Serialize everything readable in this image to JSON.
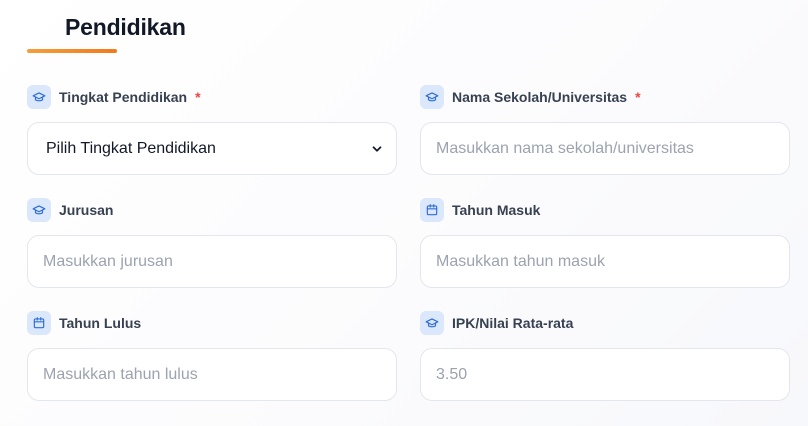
{
  "section": {
    "title": "Pendidikan",
    "accent_color": "#f17a1c"
  },
  "fields": {
    "tingkat": {
      "label": "Tingkat Pendidikan",
      "required_mark": "*",
      "selected": "Pilih Tingkat Pendidikan",
      "icon": "graduation-cap-icon"
    },
    "sekolah": {
      "label": "Nama Sekolah/Universitas",
      "required_mark": "*",
      "placeholder": "Masukkan nama sekolah/universitas",
      "icon": "graduation-cap-icon"
    },
    "jurusan": {
      "label": "Jurusan",
      "placeholder": "Masukkan jurusan",
      "icon": "graduation-cap-icon"
    },
    "tahun_masuk": {
      "label": "Tahun Masuk",
      "placeholder": "Masukkan tahun masuk",
      "icon": "calendar-icon"
    },
    "tahun_lulus": {
      "label": "Tahun Lulus",
      "placeholder": "Masukkan tahun lulus",
      "icon": "calendar-icon"
    },
    "ipk": {
      "label": "IPK/Nilai Rata-rata",
      "placeholder": "3.50",
      "icon": "graduation-cap-icon"
    }
  },
  "colors": {
    "icon_bg": "#dbe7fb",
    "icon_fg": "#2f6fd6",
    "required": "#ef4444",
    "border": "#e3e6ec"
  }
}
